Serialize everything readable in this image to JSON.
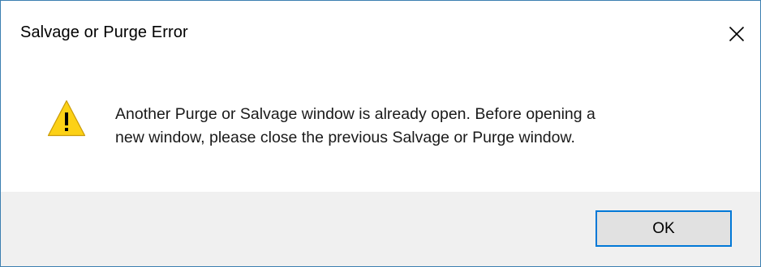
{
  "window": {
    "title": "Salvage or Purge Error",
    "close_icon": "close-icon"
  },
  "message": {
    "icon": "warning-icon",
    "line1": "Another Purge or Salvage window is already open. Before opening a",
    "line2": "new window, please close the previous Salvage or Purge window."
  },
  "buttons": {
    "ok_label": "OK"
  },
  "colors": {
    "border": "#3c7fb1",
    "footer_bg": "#f0f0f0",
    "button_bg": "#e1e1e1",
    "button_focus": "#0078d7",
    "warning_yellow": "#fcd116"
  }
}
